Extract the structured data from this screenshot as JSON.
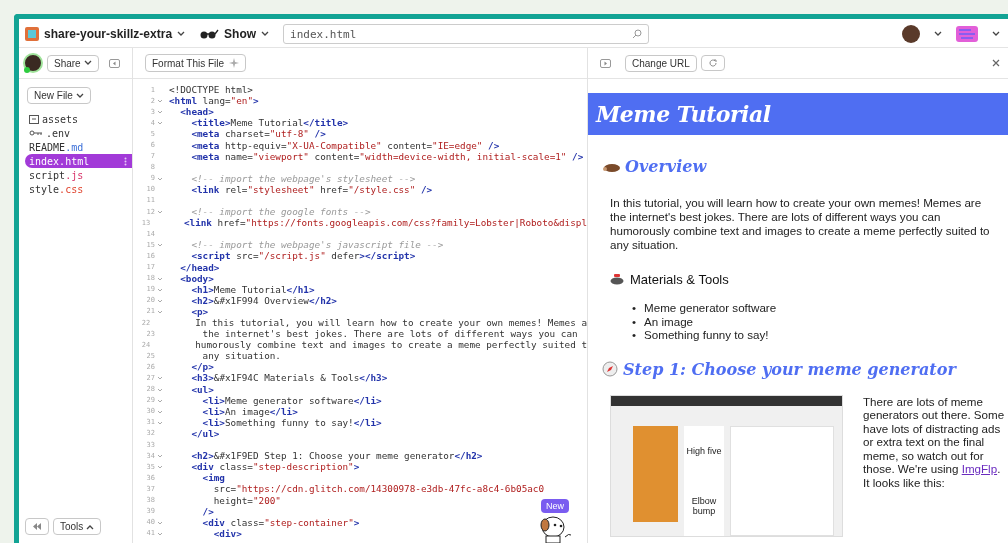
{
  "topbar": {
    "project": "share-your-skillz-extra",
    "show": "Show",
    "file_search": "index.html"
  },
  "sidebar": {
    "share": "Share",
    "new_file": "New File",
    "files": [
      {
        "kind": "folder",
        "name": "assets",
        "selected": false
      },
      {
        "kind": "env",
        "name": ".env",
        "selected": false
      },
      {
        "kind": "markdown",
        "name": "README",
        "ext": ".md",
        "selected": false
      },
      {
        "kind": "html",
        "name": "index",
        "ext": ".html",
        "selected": true
      },
      {
        "kind": "javascript",
        "name": "script",
        "ext": ".js",
        "selected": false
      },
      {
        "kind": "stylesheet",
        "name": "style",
        "ext": ".css",
        "selected": false
      }
    ],
    "tools": "Tools"
  },
  "editor": {
    "format_button": "Format This File",
    "badge": "New",
    "lines": [
      {
        "number": "1",
        "foldable": false,
        "segments": [
          {
            "kind": "text",
            "text": "<!DOCTYPE html>"
          }
        ]
      },
      {
        "number": "2",
        "foldable": true,
        "segments": [
          {
            "kind": "tag",
            "text": "<html"
          },
          {
            "kind": "attr",
            "text": " lang="
          },
          {
            "kind": "string",
            "text": "\"en\""
          },
          {
            "kind": "tag",
            "text": ">"
          }
        ]
      },
      {
        "number": "3",
        "foldable": true,
        "segments": [
          {
            "kind": "tag",
            "text": "  <head>"
          }
        ]
      },
      {
        "number": "4",
        "foldable": true,
        "segments": [
          {
            "kind": "tag",
            "text": "    <title>"
          },
          {
            "kind": "text",
            "text": "Meme Tutorial"
          },
          {
            "kind": "tag",
            "text": "</title>"
          }
        ]
      },
      {
        "number": "5",
        "foldable": false,
        "segments": [
          {
            "kind": "tag",
            "text": "    <meta"
          },
          {
            "kind": "attr",
            "text": " charset="
          },
          {
            "kind": "string",
            "text": "\"utf-8\""
          },
          {
            "kind": "tag",
            "text": " />"
          }
        ]
      },
      {
        "number": "6",
        "foldable": false,
        "segments": [
          {
            "kind": "tag",
            "text": "    <meta"
          },
          {
            "kind": "attr",
            "text": " http-equiv="
          },
          {
            "kind": "string",
            "text": "\"X-UA-Compatible\""
          },
          {
            "kind": "attr",
            "text": " content="
          },
          {
            "kind": "string",
            "text": "\"IE=edge\""
          },
          {
            "kind": "tag",
            "text": " />"
          }
        ]
      },
      {
        "number": "7",
        "foldable": false,
        "segments": [
          {
            "kind": "tag",
            "text": "    <meta"
          },
          {
            "kind": "attr",
            "text": " name="
          },
          {
            "kind": "string",
            "text": "\"viewport\""
          },
          {
            "kind": "attr",
            "text": " content="
          },
          {
            "kind": "string",
            "text": "\"width=device-width, initial-scale=1\""
          },
          {
            "kind": "tag",
            "text": " />"
          }
        ]
      },
      {
        "number": "8",
        "foldable": false
      },
      {
        "number": "9",
        "foldable": true,
        "segments": [
          {
            "kind": "comment",
            "text": "    <!-- import the webpage's stylesheet -->"
          }
        ]
      },
      {
        "number": "10",
        "foldable": false,
        "segments": [
          {
            "kind": "tag",
            "text": "    <link"
          },
          {
            "kind": "attr",
            "text": " rel="
          },
          {
            "kind": "string",
            "text": "\"stylesheet\""
          },
          {
            "kind": "attr",
            "text": " href="
          },
          {
            "kind": "string",
            "text": "\"/style.css\""
          },
          {
            "kind": "tag",
            "text": " />"
          }
        ]
      },
      {
        "number": "11",
        "foldable": false
      },
      {
        "number": "12",
        "foldable": true,
        "segments": [
          {
            "kind": "comment",
            "text": "    <!-- import the google fonts -->"
          }
        ]
      },
      {
        "number": "13",
        "foldable": false,
        "segments": [
          {
            "kind": "tag",
            "text": "    <link"
          },
          {
            "kind": "attr",
            "text": " href="
          },
          {
            "kind": "string",
            "text": "\"https://fonts.googleapis.com/css?family=Lobster|Roboto&displ"
          }
        ]
      },
      {
        "number": "14",
        "foldable": false
      },
      {
        "number": "15",
        "foldable": true,
        "segments": [
          {
            "kind": "comment",
            "text": "    <!-- import the webpage's javascript file -->"
          }
        ]
      },
      {
        "number": "16",
        "foldable": false,
        "segments": [
          {
            "kind": "tag",
            "text": "    <script"
          },
          {
            "kind": "attr",
            "text": " src="
          },
          {
            "kind": "string",
            "text": "\"/script.js\""
          },
          {
            "kind": "attr",
            "text": " defer"
          },
          {
            "kind": "tag",
            "text": "></script>"
          }
        ]
      },
      {
        "number": "17",
        "foldable": false,
        "segments": [
          {
            "kind": "tag",
            "text": "  </head>"
          }
        ]
      },
      {
        "number": "18",
        "foldable": true,
        "segments": [
          {
            "kind": "tag",
            "text": "  <body>"
          }
        ]
      },
      {
        "number": "19",
        "foldable": true,
        "segments": [
          {
            "kind": "tag",
            "text": "    <h1>"
          },
          {
            "kind": "text",
            "text": "Meme Tutorial"
          },
          {
            "kind": "tag",
            "text": "</h1>"
          }
        ]
      },
      {
        "number": "20",
        "foldable": true,
        "segments": [
          {
            "kind": "tag",
            "text": "    <h2>"
          },
          {
            "kind": "text",
            "text": "&#x1F994 Overview"
          },
          {
            "kind": "tag",
            "text": "</h2>"
          }
        ]
      },
      {
        "number": "21",
        "foldable": true,
        "segments": [
          {
            "kind": "tag",
            "text": "    <p>"
          }
        ]
      },
      {
        "number": "22",
        "foldable": false,
        "segments": [
          {
            "kind": "text",
            "text": "      In this tutorial, you will learn how to create your own memes! Memes a"
          }
        ]
      },
      {
        "number": "23",
        "foldable": false,
        "segments": [
          {
            "kind": "text",
            "text": "      the internet's best jokes. There are lots of different ways you can"
          }
        ]
      },
      {
        "number": "24",
        "foldable": false,
        "segments": [
          {
            "kind": "text",
            "text": "      humorously combine text and images to create a meme perfectly suited t"
          }
        ]
      },
      {
        "number": "25",
        "foldable": false,
        "segments": [
          {
            "kind": "text",
            "text": "      any situation."
          }
        ]
      },
      {
        "number": "26",
        "foldable": false,
        "segments": [
          {
            "kind": "tag",
            "text": "    </p>"
          }
        ]
      },
      {
        "number": "27",
        "foldable": true,
        "segments": [
          {
            "kind": "tag",
            "text": "    <h3>"
          },
          {
            "kind": "text",
            "text": "&#x1F94C Materials & Tools"
          },
          {
            "kind": "tag",
            "text": "</h3>"
          }
        ]
      },
      {
        "number": "28",
        "foldable": true,
        "segments": [
          {
            "kind": "tag",
            "text": "    <ul>"
          }
        ]
      },
      {
        "number": "29",
        "foldable": true,
        "segments": [
          {
            "kind": "tag",
            "text": "      <li>"
          },
          {
            "kind": "text",
            "text": "Meme generator software"
          },
          {
            "kind": "tag",
            "text": "</li>"
          }
        ]
      },
      {
        "number": "30",
        "foldable": true,
        "segments": [
          {
            "kind": "tag",
            "text": "      <li>"
          },
          {
            "kind": "text",
            "text": "An image"
          },
          {
            "kind": "tag",
            "text": "</li>"
          }
        ]
      },
      {
        "number": "31",
        "foldable": true,
        "segments": [
          {
            "kind": "tag",
            "text": "      <li>"
          },
          {
            "kind": "text",
            "text": "Something funny to say!"
          },
          {
            "kind": "tag",
            "text": "</li>"
          }
        ]
      },
      {
        "number": "32",
        "foldable": false,
        "segments": [
          {
            "kind": "tag",
            "text": "    </ul>"
          }
        ]
      },
      {
        "number": "33",
        "foldable": false
      },
      {
        "number": "34",
        "foldable": true,
        "segments": [
          {
            "kind": "tag",
            "text": "    <h2>"
          },
          {
            "kind": "text",
            "text": "&#x1F9ED Step 1: Choose your meme generator"
          },
          {
            "kind": "tag",
            "text": "</h2>"
          }
        ]
      },
      {
        "number": "35",
        "foldable": true,
        "segments": [
          {
            "kind": "tag",
            "text": "    <div"
          },
          {
            "kind": "attr",
            "text": " class="
          },
          {
            "kind": "string",
            "text": "\"step-description\""
          },
          {
            "kind": "tag",
            "text": ">"
          }
        ]
      },
      {
        "number": "36",
        "foldable": false,
        "segments": [
          {
            "kind": "tag",
            "text": "      <img"
          }
        ]
      },
      {
        "number": "37",
        "foldable": false,
        "segments": [
          {
            "kind": "attr",
            "text": "        src="
          },
          {
            "kind": "string",
            "text": "\"https://cdn.glitch.com/14300978-e3db-47fc-a8c4-6b05ac0"
          }
        ]
      },
      {
        "number": "38",
        "foldable": false,
        "segments": [
          {
            "kind": "attr",
            "text": "        height="
          },
          {
            "kind": "string",
            "text": "\"200\""
          }
        ]
      },
      {
        "number": "39",
        "foldable": false,
        "segments": [
          {
            "kind": "tag",
            "text": "      />"
          }
        ]
      },
      {
        "number": "40",
        "foldable": true,
        "segments": [
          {
            "kind": "tag",
            "text": "      <div"
          },
          {
            "kind": "attr",
            "text": " class="
          },
          {
            "kind": "string",
            "text": "\"step-container\""
          },
          {
            "kind": "tag",
            "text": ">"
          }
        ]
      },
      {
        "number": "41",
        "foldable": true,
        "segments": [
          {
            "kind": "tag",
            "text": "        <div>"
          }
        ]
      }
    ]
  },
  "preview": {
    "change_url": "Change URL",
    "title": "Meme Tutorial",
    "overview": "Overview",
    "intro": "In this tutorial, you will learn how to create your own memes! Memes are the internet's best jokes. There are lots of different ways you can humorously combine text and images to create a meme perfectly suited to any situation.",
    "materials": "Materials & Tools",
    "items": [
      {
        "bullet": "•",
        "text": "Meme generator software"
      },
      {
        "bullet": "•",
        "text": "An image"
      },
      {
        "bullet": "•",
        "text": "Something funny to say!"
      }
    ],
    "step1": "Step 1: Choose your meme generator",
    "screenshot_captions": [
      "High five",
      "Elbow bump"
    ],
    "step1_text": "There are lots of meme generators out there. Some have lots of distracting ads or extra text on the final meme, so watch out for those. We're using ",
    "step1_link": "ImgFlp",
    "step1_end": ". It looks like this:"
  }
}
